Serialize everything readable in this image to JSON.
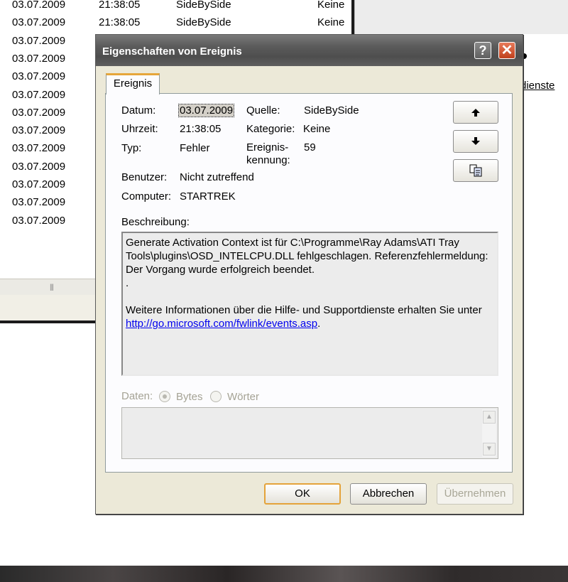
{
  "background_list": {
    "rows": [
      {
        "date": "03.07.2009",
        "time": "21:38:05",
        "source": "SideBySide",
        "category": "Keine"
      },
      {
        "date": "03.07.2009",
        "time": "21:38:05",
        "source": "SideBySide",
        "category": "Keine"
      },
      {
        "date": "03.07.2009"
      },
      {
        "date": "03.07.2009"
      },
      {
        "date": "03.07.2009"
      },
      {
        "date": "03.07.2009"
      },
      {
        "date": "03.07.2009"
      },
      {
        "date": "03.07.2009"
      },
      {
        "date": "03.07.2009"
      },
      {
        "date": "03.07.2009"
      },
      {
        "date": "03.07.2009"
      },
      {
        "date": "03.07.2009"
      },
      {
        "date": "03.07.2009"
      }
    ],
    "scroll_grip": "|||"
  },
  "background_right": {
    "link_fragment": "dienste"
  },
  "dialog": {
    "title": "Eigenschaften von Ereignis",
    "help_glyph": "?",
    "close_glyph": "✕",
    "tab_label": "Ereignis",
    "fields": {
      "date_label": "Datum:",
      "date_value": "03.07.2009",
      "time_label": "Uhrzeit:",
      "time_value": "21:38:05",
      "type_label": "Typ:",
      "type_value": "Fehler",
      "user_label": "Benutzer:",
      "user_value": "Nicht zutreffend",
      "computer_label": "Computer:",
      "computer_value": "STARTREK",
      "source_label": "Quelle:",
      "source_value": "SideBySide",
      "category_label": "Kategorie:",
      "category_value": "Keine",
      "event_id_label_1": "Ereignis-",
      "event_id_label_2": "kennung:",
      "event_id_value": "59"
    },
    "nav_buttons": {
      "up_icon": "up-arrow-icon",
      "down_icon": "down-arrow-icon",
      "copy_icon": "copy-icon"
    },
    "description_label": "Beschreibung:",
    "description": {
      "line1": "Generate Activation Context ist für C:\\Programme\\Ray Adams\\ATI Tray Tools\\plugins\\OSD_INTELCPU.DLL fehlgeschlagen. Referenzfehlermeldung: Der Vorgang wurde erfolgreich beendet.",
      "line2": ".",
      "line3_prefix": "Weitere Informationen über die Hilfe- und Supportdienste erhalten Sie unter ",
      "link": "http://go.microsoft.com/fwlink/events.asp",
      "line3_suffix": "."
    },
    "data_label": "Daten:",
    "radio_bytes": "Bytes",
    "radio_words": "Wörter",
    "buttons": {
      "ok": "OK",
      "cancel": "Abbrechen",
      "apply": "Übernehmen"
    }
  }
}
